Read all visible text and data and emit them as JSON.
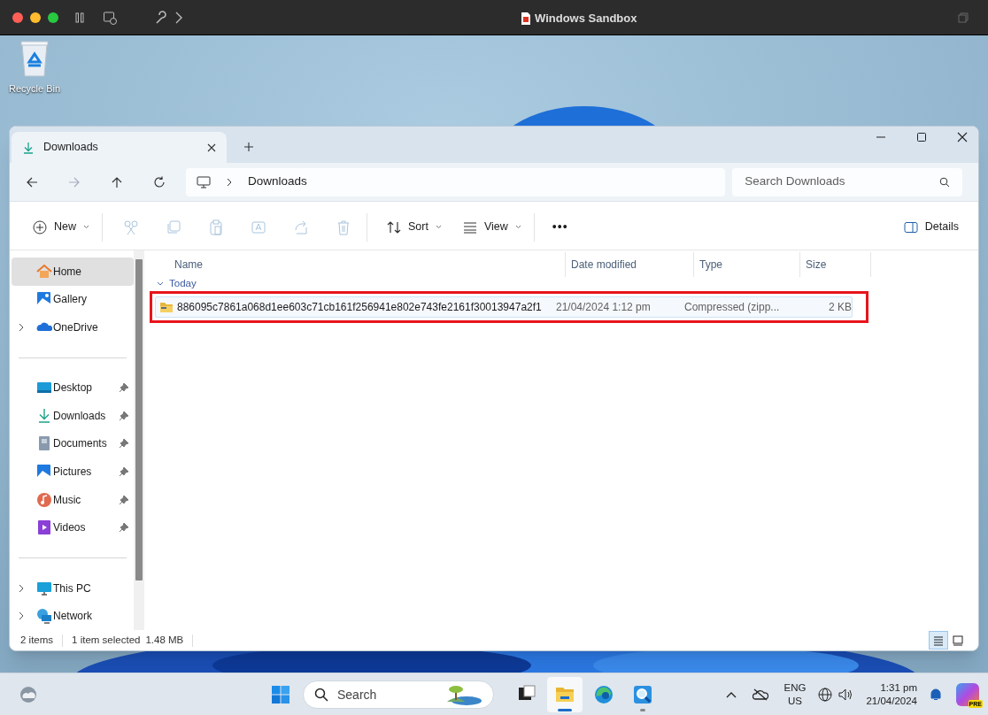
{
  "host_window": {
    "title": "Windows Sandbox"
  },
  "desktop_icons": [
    {
      "label": "Recycle Bin"
    }
  ],
  "explorer": {
    "tabs": [
      {
        "label": "Downloads",
        "selected": true
      }
    ],
    "address": {
      "path": [
        "Downloads"
      ]
    },
    "search": {
      "placeholder": "Search Downloads"
    },
    "commands": [
      {
        "kind": "menu",
        "label": "New",
        "disabled": false
      },
      {
        "kind": "icon",
        "disabled": true
      },
      {
        "kind": "icon",
        "disabled": true
      },
      {
        "kind": "icon",
        "disabled": true
      },
      {
        "kind": "icon",
        "disabled": true
      },
      {
        "kind": "icon",
        "disabled": true
      },
      {
        "kind": "icon",
        "disabled": true
      },
      {
        "kind": "menu",
        "label": "Sort",
        "disabled": false
      },
      {
        "kind": "menu",
        "label": "View",
        "disabled": false
      },
      {
        "kind": "more",
        "label": "•••",
        "disabled": false
      }
    ],
    "details_button": {
      "label": "Details"
    },
    "sidebar": {
      "groups": [
        [
          {
            "label": "Home",
            "selected": true,
            "expandable": false,
            "pinned": false
          },
          {
            "label": "Gallery",
            "selected": false,
            "expandable": false,
            "pinned": false
          },
          {
            "label": "OneDrive",
            "selected": false,
            "expandable": true,
            "pinned": false
          }
        ],
        [
          {
            "label": "Desktop",
            "selected": false,
            "expandable": false,
            "pinned": true
          },
          {
            "label": "Downloads",
            "selected": false,
            "expandable": false,
            "pinned": true
          },
          {
            "label": "Documents",
            "selected": false,
            "expandable": false,
            "pinned": true
          },
          {
            "label": "Pictures",
            "selected": false,
            "expandable": false,
            "pinned": true
          },
          {
            "label": "Music",
            "selected": false,
            "expandable": false,
            "pinned": true
          },
          {
            "label": "Videos",
            "selected": false,
            "expandable": false,
            "pinned": true
          }
        ],
        [
          {
            "label": "This PC",
            "selected": false,
            "expandable": true,
            "pinned": false
          },
          {
            "label": "Network",
            "selected": false,
            "expandable": true,
            "pinned": false
          }
        ]
      ]
    },
    "columns": [
      {
        "label": "Name"
      },
      {
        "label": "Date modified"
      },
      {
        "label": "Type"
      },
      {
        "label": "Size"
      }
    ],
    "group": {
      "label": "Today",
      "expanded": true
    },
    "rows": [
      {
        "selected": true,
        "highlighted": true,
        "cells": [
          "886095c7861a068d1ee603c71cb161f256941e802e743fe2161f30013947a2f1",
          "21/04/2024 1:12 pm",
          "Compressed (zipp...",
          "2 KB"
        ]
      }
    ],
    "status_bar": {
      "items": [
        "2 items",
        "1 item selected",
        "1.48 MB"
      ],
      "views": [
        {
          "selected": true
        },
        {
          "selected": false
        }
      ]
    }
  },
  "taskbar": {
    "search": {
      "placeholder": "Search"
    },
    "apps": [
      {
        "selected": false,
        "running": false
      },
      {
        "selected": true,
        "running": true
      },
      {
        "selected": false,
        "running": false
      },
      {
        "selected": false,
        "running": true
      }
    ],
    "language": [
      "ENG",
      "US"
    ],
    "time": "1:31 pm",
    "date": "21/04/2024",
    "copilot_badge": "PRE"
  }
}
